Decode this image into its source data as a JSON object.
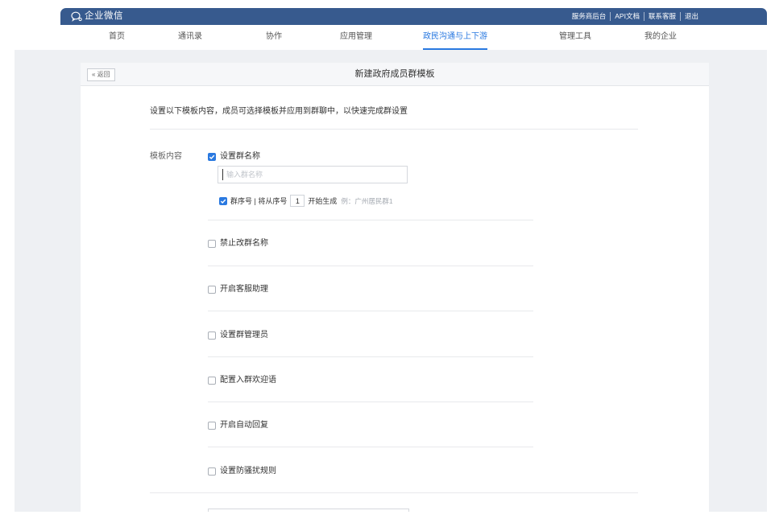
{
  "window": {
    "logo_text": "企业微信"
  },
  "header": {
    "links": [
      {
        "label": "服务商后台"
      },
      {
        "label": "API文档"
      },
      {
        "label": "联系客服"
      },
      {
        "label": "退出"
      }
    ]
  },
  "nav": {
    "active_index": 4,
    "items": [
      {
        "label": "首页"
      },
      {
        "label": "通讯录"
      },
      {
        "label": "协作"
      },
      {
        "label": "应用管理"
      },
      {
        "label": "政民沟通与上下游"
      },
      {
        "label": "管理工具"
      },
      {
        "label": "我的企业"
      }
    ]
  },
  "page": {
    "back_label": "« 返回",
    "title": "新建政府成员群模板",
    "intro": "设置以下模板内容，成员可选择模板并应用到群聊中，以快速完成群设置",
    "section_label": "模板内容"
  },
  "group_name": {
    "label": "设置群名称",
    "checked": true,
    "input": {
      "placeholder": "输入群名称",
      "value": ""
    },
    "serial": {
      "checked": true,
      "prefix": "群序号 | 将从序号",
      "start_value": "1",
      "suffix": "开始生成",
      "example": "例：广州居民群1"
    }
  },
  "options": [
    {
      "label": "禁止改群名称",
      "checked": false
    },
    {
      "label": "开启客服助理",
      "checked": false
    },
    {
      "label": "设置群管理员",
      "checked": false
    },
    {
      "label": "配置入群欢迎语",
      "checked": false
    },
    {
      "label": "开启自动回复",
      "checked": false
    },
    {
      "label": "设置防骚扰规则",
      "checked": false
    }
  ],
  "icons": {
    "logo": "wecom-logo-icon",
    "checkbox_mark": "check-icon"
  },
  "colors": {
    "header_bg": "#375a8e",
    "accent": "#2a79e0",
    "page_bg": "#eef0f3"
  }
}
